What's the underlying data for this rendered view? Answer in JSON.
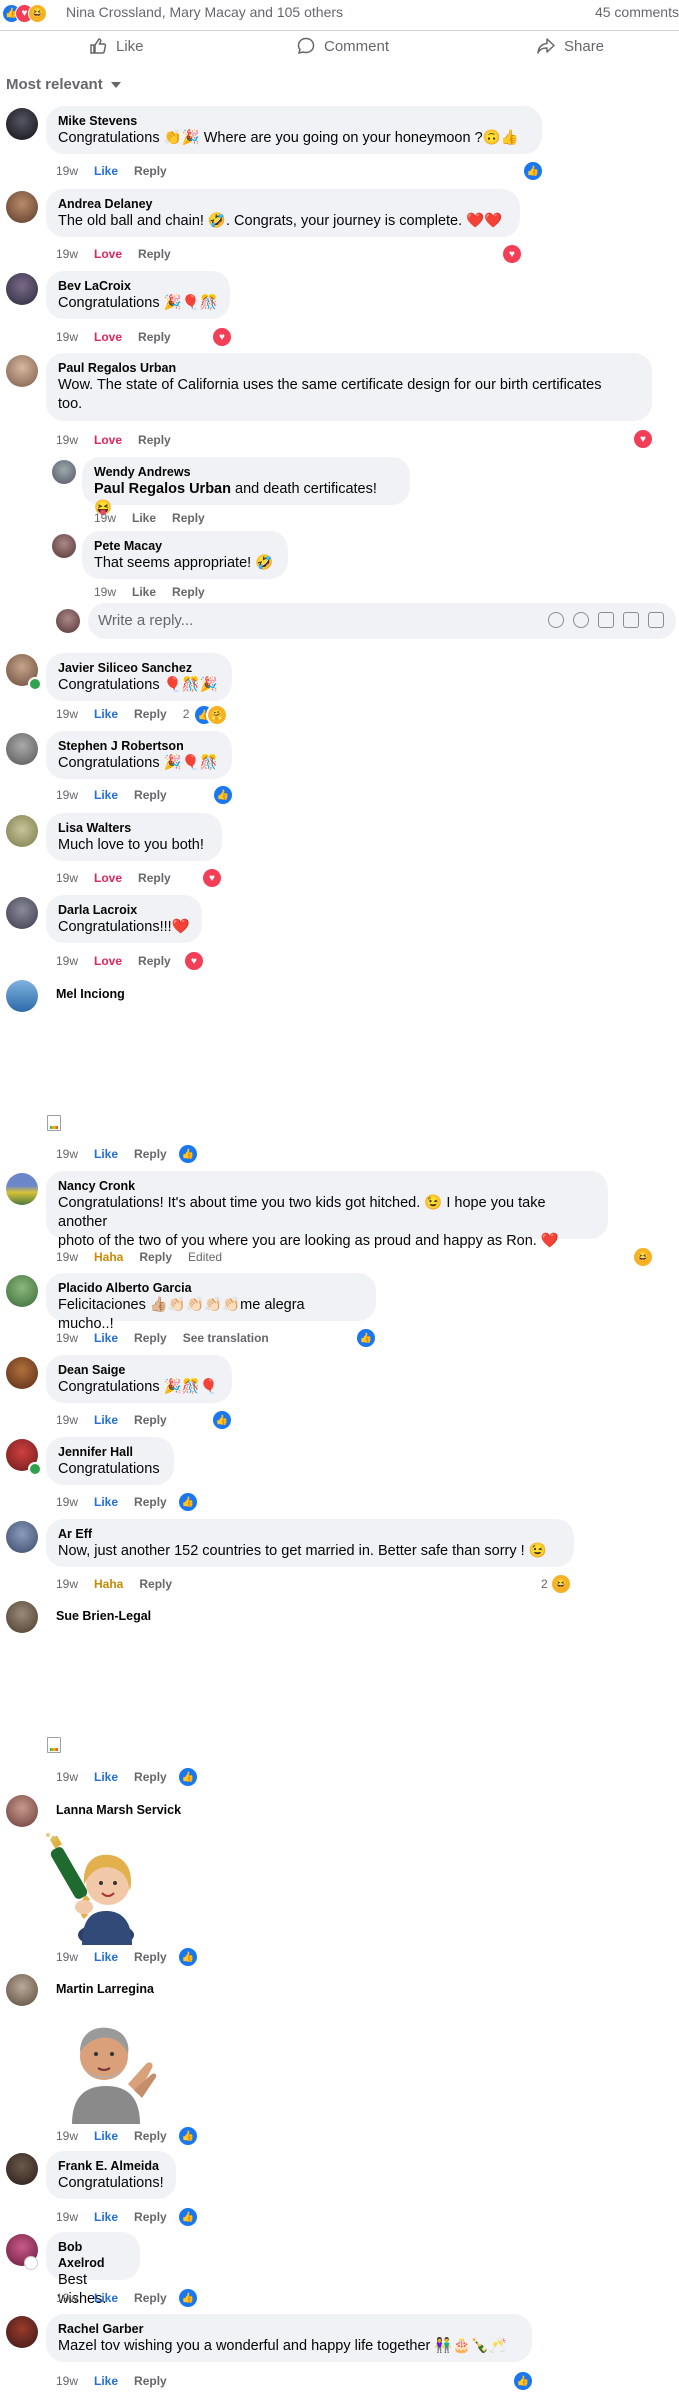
{
  "summary": {
    "names": "Nina Crossland, Mary Macay and 105 others",
    "comments": "45 comments"
  },
  "actions": {
    "like": "Like",
    "comment": "Comment",
    "share": "Share"
  },
  "sort": {
    "label": "Most relevant"
  },
  "reply_input": {
    "placeholder": "Write a reply..."
  },
  "labels": {
    "like": "Like",
    "love": "Love",
    "haha": "Haha",
    "reply": "Reply",
    "edited": "Edited",
    "see_translation": "See translation"
  },
  "comments": [
    {
      "name": "Mike Stevens",
      "text": "Congratulations 👏🎉 Where are you going on your honeymoon ?🙃👍",
      "time": "19w",
      "reaction": "Like"
    },
    {
      "name": "Andrea Delaney",
      "text": "The old ball and chain! 🤣. Congrats, your journey is complete. ❤️❤️",
      "time": "19w",
      "reaction": "Love"
    },
    {
      "name": "Bev LaCroix",
      "text": "Congratulations 🎉🎈🎊",
      "time": "19w",
      "reaction": "Love"
    },
    {
      "name": "Paul Regalos Urban",
      "text_line1": "Wow. The state of California uses the same certificate design for our birth certificates",
      "text_line2": "too.",
      "time": "19w",
      "reaction": "Love"
    },
    {
      "name": "Wendy Andrews",
      "mention": "Paul Regalos Urban",
      "text": " and death certificates! 😝",
      "time": "19w",
      "reaction": "Like"
    },
    {
      "name": "Pete Macay",
      "text": "That seems appropriate! 🤣",
      "time": "19w",
      "reaction": "Like"
    },
    {
      "name": "Javier Siliceo Sanchez",
      "text": "Congratulations 🎈🎊🎉",
      "time": "19w",
      "reaction": "Like",
      "count": "2"
    },
    {
      "name": "Stephen J Robertson",
      "text": "Congratulations 🎉🎈🎊",
      "time": "19w",
      "reaction": "Like"
    },
    {
      "name": "Lisa Walters",
      "text": "Much love to you both!",
      "time": "19w",
      "reaction": "Love"
    },
    {
      "name": "Darla Lacroix",
      "text": "Congratulations!!!❤️",
      "time": "19w",
      "reaction": "Love"
    },
    {
      "name": "Mel Inciong",
      "time": "19w",
      "reaction": "Like"
    },
    {
      "name": "Nancy Cronk",
      "text_line1": "Congratulations! It's about time you two kids got hitched. 😉 I hope you take another",
      "text_line2": "photo of the two of you where you are looking as proud and happy as Ron. ❤️",
      "time": "19w",
      "reaction": "Haha"
    },
    {
      "name": "Placido Alberto Garcia",
      "text": "Felicitaciones 👍🏼👏🏻👏🏻👏🏻👏🏻me alegra mucho..!",
      "time": "19w",
      "reaction": "Like"
    },
    {
      "name": "Dean Saige",
      "text": "Congratulations 🎉🎊🎈",
      "time": "19w",
      "reaction": "Like"
    },
    {
      "name": "Jennifer Hall",
      "text": "Congratulations",
      "time": "19w",
      "reaction": "Like"
    },
    {
      "name": "Ar Eff",
      "text": "Now, just another 152 countries to get married in. Better safe than sorry ! 😉",
      "time": "19w",
      "reaction": "Haha",
      "count": "2"
    },
    {
      "name": "Sue Brien-Legal",
      "time": "19w",
      "reaction": "Like"
    },
    {
      "name": "Lanna Marsh Servick",
      "time": "19w",
      "reaction": "Like"
    },
    {
      "name": "Martin Larregina",
      "time": "19w",
      "reaction": "Like"
    },
    {
      "name": "Frank E. Almeida",
      "text": "Congratulations!",
      "time": "19w",
      "reaction": "Like"
    },
    {
      "name": "Bob Axelrod",
      "text": "Best wishes.",
      "time": "19w",
      "reaction": "Like"
    },
    {
      "name": "Rachel Garber",
      "text": "Mazel tov wishing you a wonderful and happy life together 👫🎂🍾🥂",
      "time": "19w",
      "reaction": "Like"
    }
  ],
  "colors": {
    "like": "#216fdb",
    "love": "#e0245e",
    "haha": "#c98a04",
    "bubble": "#f0f2f5"
  }
}
